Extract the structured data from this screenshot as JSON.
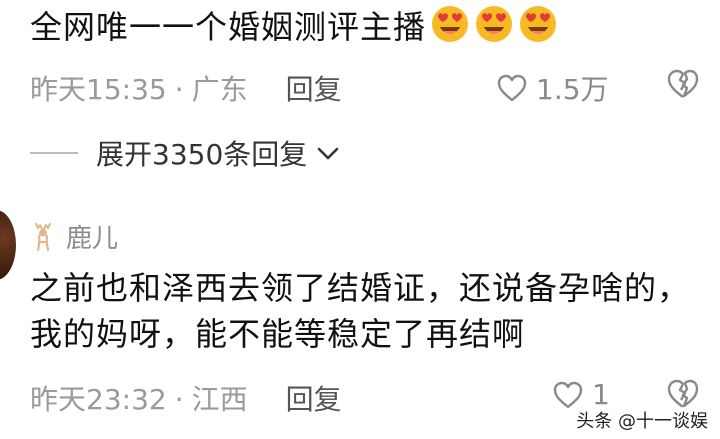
{
  "comment1": {
    "text": "全网唯一一个婚姻测评主播",
    "emojis": [
      "heart-eyes-emoji",
      "heart-eyes-emoji",
      "heart-eyes-emoji"
    ],
    "date_time": "昨天15:35",
    "separator": "·",
    "location": "广东",
    "reply_label": "回复",
    "like_count": "1.5万"
  },
  "expand": {
    "label": "展开3350条回复"
  },
  "comment2": {
    "username": "鹿儿",
    "text": "之前也和泽西去领了结婚证，还说备孕啥的，我的妈呀，能不能等稳定了再结啊",
    "date_time": "昨天23:32",
    "separator": "·",
    "location": "江西",
    "reply_label": "回复",
    "like_count": "1"
  },
  "watermark": "头条 @十一谈娱",
  "colors": {
    "text_primary": "#111111",
    "text_meta": "#9a9a9a",
    "emoji_face": "#F7B924",
    "emoji_heart": "#E53935"
  }
}
